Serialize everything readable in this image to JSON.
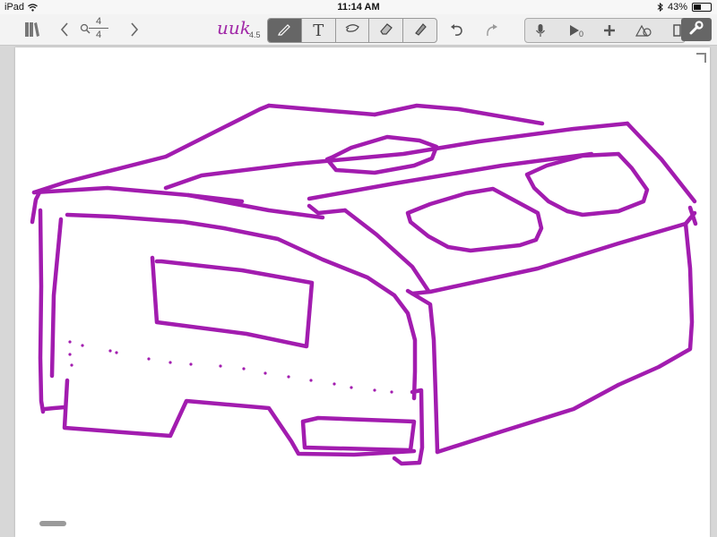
{
  "status_bar": {
    "device": "iPad",
    "time": "11:14 AM",
    "battery": "43%",
    "battery_level": 0.43
  },
  "toolbar": {
    "page_current": "4",
    "page_total": "4",
    "logo_text": "uuk",
    "logo_version": "4.5",
    "player_count": "0",
    "tools": [
      "pen-icon",
      "text-icon",
      "lasso-icon",
      "eraser-icon",
      "highlighter-icon"
    ],
    "active_tool": "pen",
    "secondary": [
      "undo-icon",
      "redo-icon"
    ],
    "right_tools": [
      "microphone-icon",
      "play-icon",
      "add-icon",
      "shapes-icon",
      "page-icon"
    ],
    "settings": "wrench-icon"
  },
  "drawing": {
    "ink_color": "#a21caf",
    "subject": "sketch-of-boxy-vehicle"
  },
  "colors": {
    "toolbar_bg": "#f3f3f3",
    "active_tool_bg": "#666666",
    "canvas_bg": "#ffffff"
  }
}
